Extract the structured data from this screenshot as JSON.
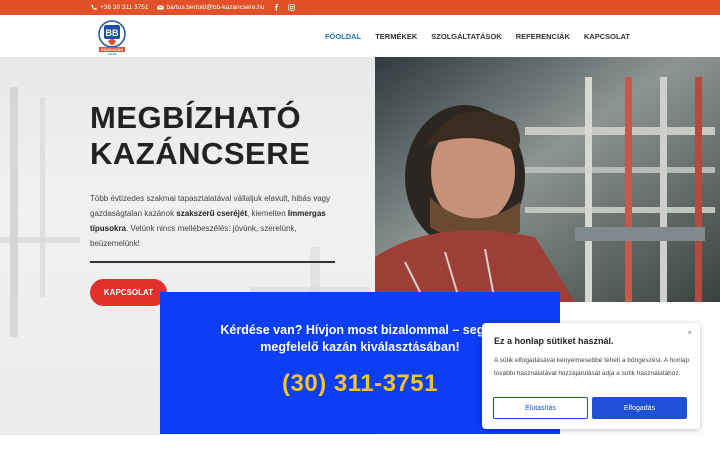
{
  "topbar": {
    "phone": "+36 30 311 3751",
    "email": "bartus.bertold@bb-kazancsere.hu",
    "social": [
      "facebook-icon",
      "instagram-icon"
    ]
  },
  "logo": {
    "text": "BB",
    "subtitle": "GÁZKAZÁN",
    "subtitle2": "CSERE"
  },
  "nav": {
    "items": [
      {
        "label": "FŐOLDAL",
        "active": true
      },
      {
        "label": "TERMÉKEK",
        "active": false
      },
      {
        "label": "SZOLGÁLTATÁSOK",
        "active": false
      },
      {
        "label": "REFERENCIÁK",
        "active": false
      },
      {
        "label": "KAPCSOLAT",
        "active": false
      }
    ]
  },
  "hero": {
    "title_line1": "MEGBÍZHATÓ",
    "title_line2": "KAZÁNCSERE",
    "desc_1": "Több évtizedes szakmai tapasztalatával vállaljuk elavult, hibás vagy gazdaságtalan kazánok ",
    "desc_bold1": "szakszerű cseréjét",
    "desc_2": ", kiemelten ",
    "desc_bold2": "Immergas típusokra",
    "desc_3": ". Velünk nincs mellébeszélés: jövünk, szerelünk, beüzemelünk!",
    "cta_label": "KAPCSOLAT"
  },
  "callout": {
    "question": "Kérdése van? Hívjon most bizalommal – segítü",
    "question2": "megfelelő kazán kiválasztásában!",
    "phone": "(30) 311-3751"
  },
  "cookie": {
    "title": "Ez a honlap sütiket használ.",
    "text": "A sütik elfogadásával kényelmesebbé teheti a böngészést. A honlap további használatával hozzájárulását adja a sütik használatához.",
    "reject_label": "Elutasítás",
    "accept_label": "Elfogadás",
    "close": "×"
  },
  "colors": {
    "topbar": "#e2502a",
    "nav_active": "#1e73be",
    "cta": "#e2302a",
    "callout_bg": "#0b3ef5",
    "phone": "#f7c22a"
  }
}
